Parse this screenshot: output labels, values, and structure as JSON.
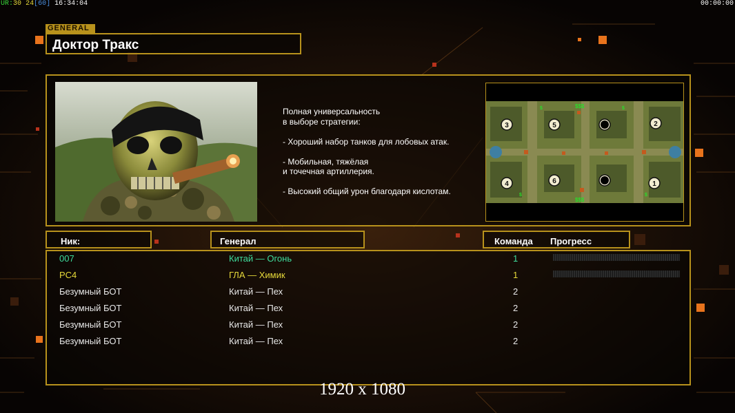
{
  "overlay": {
    "fps_prefix": "UR",
    "fps_a": "30",
    "fps_b": "24",
    "fps_c": "[60]",
    "clock": "16:34:04",
    "timer": "00:00:00"
  },
  "general": {
    "tag": "GENERAL",
    "name": "Доктор Тракс",
    "description_lines": [
      "Полная универсальность",
      "в выборе стратегии:",
      "",
      "- Хороший набор танков для лобовых атак.",
      "",
      "- Мобильная, тяжёлая",
      "и точечная артиллерия.",
      "",
      "- Высокий общий урон благодаря кислотам."
    ]
  },
  "minimap": {
    "spawn_labels": [
      "3",
      "5",
      "2",
      "4",
      "6",
      "1"
    ],
    "money_label": "$$$"
  },
  "columns": {
    "nick": "Ник:",
    "general": "Генерал",
    "team": "Команда",
    "progress": "Прогресс"
  },
  "players": [
    {
      "nick": "007",
      "general": "Китай — Огонь",
      "team": "1",
      "progress_visible": true,
      "color": "#3fdc9c"
    },
    {
      "nick": "PC4",
      "general": "ГЛА — Химик",
      "team": "1",
      "progress_visible": true,
      "color": "#e6d93a"
    },
    {
      "nick": "Безумный БОТ",
      "general": "Китай — Пех",
      "team": "2",
      "progress_visible": false,
      "color": "#e8e8e8"
    },
    {
      "nick": "Безумный БОТ",
      "general": "Китай — Пех",
      "team": "2",
      "progress_visible": false,
      "color": "#e8e8e8"
    },
    {
      "nick": "Безумный БОТ",
      "general": "Китай — Пех",
      "team": "2",
      "progress_visible": false,
      "color": "#e8e8e8"
    },
    {
      "nick": "Безумный БОТ",
      "general": "Китай — Пех",
      "team": "2",
      "progress_visible": false,
      "color": "#e8e8e8"
    }
  ],
  "resolution": "1920 x 1080",
  "colors": {
    "gold": "#b8921c",
    "accent_orange": "#e8731c",
    "background": "#0b0604"
  }
}
